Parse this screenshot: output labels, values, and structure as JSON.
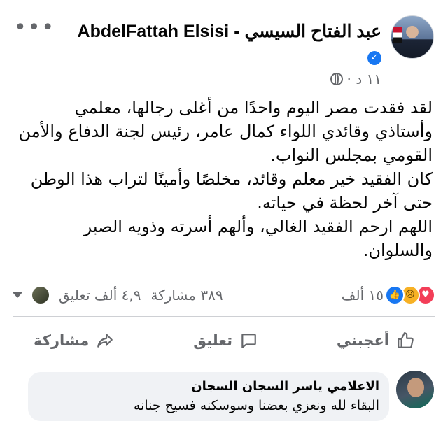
{
  "post": {
    "author": "عبد الفتاح السيسي - AbdelFattah Elsisi",
    "verified_mark": "✓",
    "timestamp": "١١ د ·",
    "more_label": "•••",
    "body_lines": [
      "لقد فقدت مصر اليوم واحدًا من أغلى رجالها، معلمي",
      "وأستاذي وقائدي اللواء كمال عامر، رئيس لجنة الدفاع والأمن",
      "القومي بمجلس النواب.",
      "كان الفقيد خير معلم وقائد، مخلصًا وأمينًا لتراب هذا الوطن",
      "حتى آخر لحظة في حياته.",
      "اللهم ارحم الفقيد الغالي، وألهم أسرته وذويه الصبر",
      "والسلوان."
    ]
  },
  "stats": {
    "reactions_count": "١٥ ألف",
    "comments_count": "٤,٩ ألف تعليق",
    "shares_count": "٣٨٩ مشاركة",
    "reaction_icons": [
      "like-icon",
      "sad-icon",
      "love-icon"
    ]
  },
  "actions": {
    "like_label": "أعجبني",
    "comment_label": "تعليق",
    "share_label": "مشاركة"
  },
  "comment": {
    "author": "الاعلامي ياسر السجان السجان",
    "text": "البقاء لله ونعزي بعضنا وسوسكنه فسيح جنانه"
  },
  "colors": {
    "brand_blue": "#1877f2",
    "secondary_text": "#65676b",
    "divider": "#ced0d4"
  }
}
